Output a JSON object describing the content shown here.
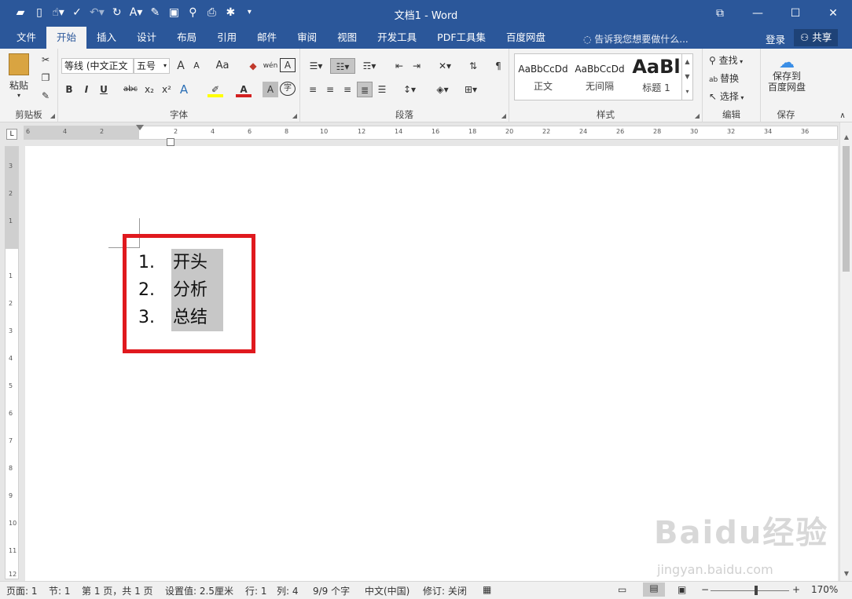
{
  "window": {
    "title": "文档1 - Word"
  },
  "qat": {
    "items": [
      "open-icon",
      "new-icon",
      "touch-icon",
      "spelling-icon",
      "undo-icon",
      "redo-icon",
      "format-icon",
      "insert-icon",
      "save-icon",
      "find-icon",
      "print-preview-icon",
      "addon-icon",
      "customize-icon"
    ]
  },
  "tabs": [
    "文件",
    "开始",
    "插入",
    "设计",
    "布局",
    "引用",
    "邮件",
    "审阅",
    "视图",
    "开发工具",
    "PDF工具集",
    "百度网盘"
  ],
  "tell_me": "告诉我您想要做什么...",
  "account": {
    "login": "登录",
    "share": "共享"
  },
  "ribbon": {
    "clipboard": {
      "label": "剪贴板",
      "paste": "粘贴"
    },
    "font": {
      "label": "字体",
      "font_name": "等线 (中文正文",
      "font_size": "五号",
      "bold": "B",
      "italic": "I",
      "underline": "U",
      "strike": "abc",
      "sub": "x₂",
      "sup": "x²",
      "grow": "A",
      "shrink": "A",
      "case": "Aa",
      "wen": "wén",
      "border_char": "A",
      "char_shade": "A",
      "circle_char": "字"
    },
    "paragraph": {
      "label": "段落"
    },
    "styles": {
      "label": "样式",
      "items": [
        {
          "preview": "AaBbCcDd",
          "name": "正文"
        },
        {
          "preview": "AaBbCcDd",
          "name": "无间隔"
        },
        {
          "preview": "AaBl",
          "name": "标题 1"
        }
      ]
    },
    "editing": {
      "label": "编辑",
      "find": "查找",
      "replace": "替换",
      "select": "选择"
    },
    "save": {
      "label": "保存",
      "save_to": "保存到",
      "baidu": "百度网盘"
    }
  },
  "ruler": {
    "h_ticks": [
      "6",
      "4",
      "2",
      "2",
      "4",
      "6",
      "8",
      "10",
      "12",
      "14",
      "16",
      "18",
      "20",
      "22",
      "24",
      "26",
      "28",
      "30",
      "32",
      "34",
      "36"
    ],
    "v_ticks": [
      "3",
      "2",
      "1",
      "1",
      "2",
      "3",
      "4",
      "5",
      "6",
      "7",
      "8",
      "9",
      "10",
      "11",
      "12"
    ]
  },
  "document": {
    "list": [
      {
        "num": "1.",
        "text": "开头"
      },
      {
        "num": "2.",
        "text": "分析"
      },
      {
        "num": "3.",
        "text": "总结"
      }
    ]
  },
  "status": {
    "page": "页面: 1",
    "section": "节: 1",
    "page_of": "第 1 页，共 1 页",
    "setting": "设置值: 2.5厘米",
    "line": "行: 1",
    "col": "列: 4",
    "chars": "9/9 个字",
    "lang": "中文(中国)",
    "track": "修订: 关闭",
    "zoom": "170%"
  },
  "watermark": {
    "brand": "Baidu经验",
    "url": "jingyan.baidu.com"
  }
}
